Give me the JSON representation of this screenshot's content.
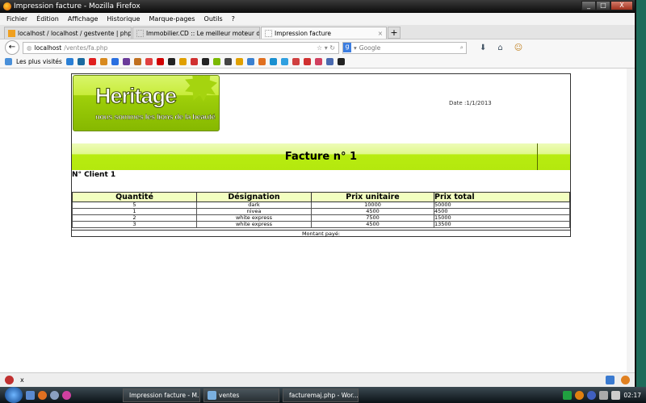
{
  "window": {
    "title": "Impression facture - Mozilla Firefox",
    "controls": [
      "_",
      "□",
      "X"
    ]
  },
  "menu": [
    "Fichier",
    "Édition",
    "Affichage",
    "Historique",
    "Marque-pages",
    "Outils",
    "?"
  ],
  "tabs": [
    {
      "label": "localhost / localhost / gestvente | phpMy...",
      "active": false
    },
    {
      "label": "Immobilier.CD :: Le meilleur moteur de re...",
      "active": false
    },
    {
      "label": "Impression facture",
      "active": true
    }
  ],
  "nav": {
    "url_host": "localhost",
    "url_path": "/ventes/fa.php",
    "search_placeholder": "Google"
  },
  "bookmarks": {
    "most_visited": "Les plus visités",
    "icon_colors": [
      "#2a7fd6",
      "#1a6aa0",
      "#e02020",
      "#d88a20",
      "#2a6fe0",
      "#6a3a9a",
      "#c07020",
      "#e04040",
      "#d00000",
      "#222",
      "#e0a000",
      "#d03030",
      "#222",
      "#7ab800",
      "#444",
      "#e0a000",
      "#3a80d0",
      "#e07020",
      "#1a90d0",
      "#30a0e0",
      "#d04040",
      "#d03030",
      "#d04060",
      "#4a6ab0",
      "#222"
    ]
  },
  "invoice": {
    "brand": "Heritage",
    "slogan": "nous sommes les lions de la beauté",
    "date": "Date :1/1/2013",
    "title": "Facture n° 1",
    "client": "N° Client 1",
    "columns": [
      "Quantité",
      "Désignation",
      "Prix unitaire",
      "Prix total"
    ],
    "rows": [
      [
        "5",
        "dark",
        "10000",
        "50000"
      ],
      [
        "1",
        "nivea",
        "4500",
        "4500"
      ],
      [
        "2",
        "white express",
        "7500",
        "15000"
      ],
      [
        "3",
        "white express",
        "4500",
        "13500"
      ]
    ],
    "montant": "Montant payé:"
  },
  "statusbar": {
    "close": "x"
  },
  "taskbar": {
    "tasks": [
      "Impression facture - M...",
      "ventes",
      "facturemaj.php - Wor..."
    ],
    "clock": "02:17"
  }
}
